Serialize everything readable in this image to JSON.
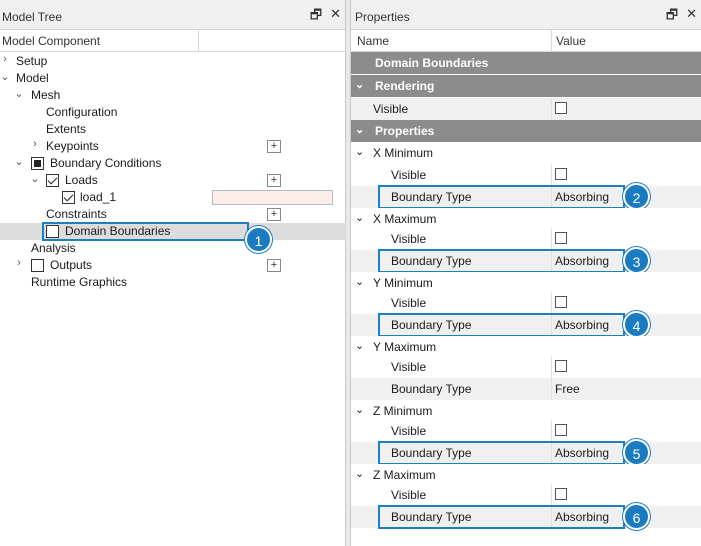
{
  "left": {
    "title": "Model Tree",
    "column_header": "Model Component",
    "tree": [
      {
        "label": "Setup",
        "arrow": "›"
      },
      {
        "label": "Model",
        "arrow": "⌄"
      },
      {
        "label": "Mesh",
        "arrow": "⌄"
      },
      {
        "label": "Configuration"
      },
      {
        "label": "Extents"
      },
      {
        "label": "Keypoints",
        "arrow": "›"
      },
      {
        "label": "Boundary Conditions",
        "arrow": "⌄"
      },
      {
        "label": "Loads",
        "arrow": "⌄"
      },
      {
        "label": "load_1"
      },
      {
        "label": "Constraints"
      },
      {
        "label": "Domain Boundaries"
      },
      {
        "label": "Analysis"
      },
      {
        "label": "Outputs",
        "arrow": "›"
      },
      {
        "label": "Runtime Graphics"
      }
    ],
    "plus_symbol": "+",
    "badge": "1"
  },
  "right": {
    "title": "Properties",
    "col_name": "Name",
    "col_value": "Value",
    "section_title": "Domain Boundaries",
    "rendering": "Rendering",
    "properties": "Properties",
    "visible": "Visible",
    "groups": [
      {
        "name": "X Minimum",
        "type_label": "Boundary Type",
        "type_value": "Absorbing",
        "badge": "2"
      },
      {
        "name": "X Maximum",
        "type_label": "Boundary Type",
        "type_value": "Absorbing",
        "badge": "3"
      },
      {
        "name": "Y Minimum",
        "type_label": "Boundary Type",
        "type_value": "Absorbing",
        "badge": "4"
      },
      {
        "name": "Y Maximum",
        "type_label": "Boundary Type",
        "type_value": "Free",
        "badge": ""
      },
      {
        "name": "Z Minimum",
        "type_label": "Boundary Type",
        "type_value": "Absorbing",
        "badge": "5"
      },
      {
        "name": "Z Maximum",
        "type_label": "Boundary Type",
        "type_value": "Absorbing",
        "badge": "6"
      }
    ]
  },
  "icons": {
    "float": "restore-icon",
    "close": "close-icon"
  },
  "colors": {
    "accent": "#1e7fbf",
    "badge": "#1a7bc1",
    "category": "#8c8c8c",
    "load_color": "#fbeee8"
  }
}
